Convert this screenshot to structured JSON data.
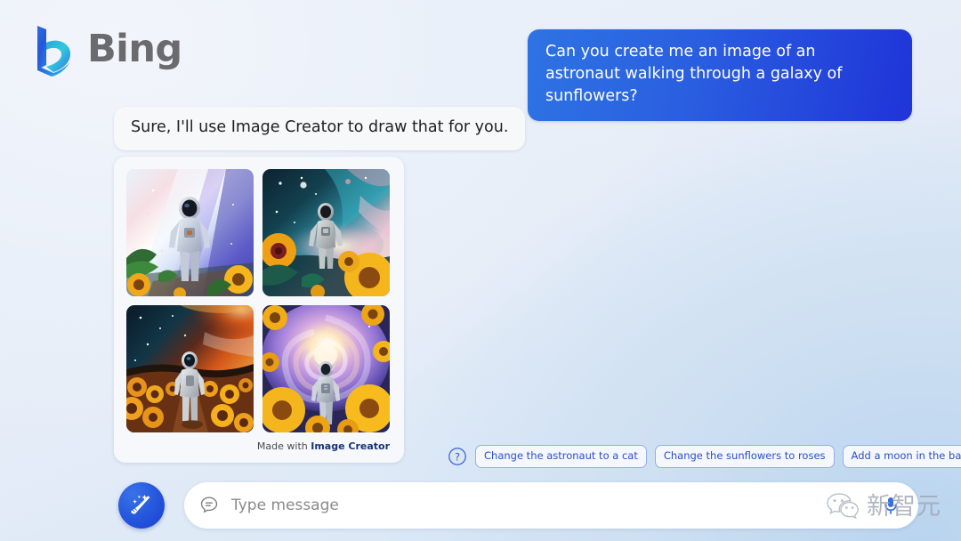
{
  "brand": {
    "name": "Bing",
    "logo_icon": "bing-b-logo-icon",
    "logo_colors": [
      "#2c64d8",
      "#1ea7c8",
      "#3ad0d8"
    ]
  },
  "conversation": {
    "user_message": "Can you create me an image of an astronaut walking through a galaxy of sunflowers?",
    "user_bubble_color": "#2a5fe0",
    "bot_message": "Sure, I'll use Image Creator to draw that for you.",
    "bot_bubble_color": "#f7f8fa"
  },
  "image_results": {
    "attribution_prefix": "Made with ",
    "attribution_brand": "Image Creator",
    "attribution_brand_color": "#18347a",
    "thumbnails": [
      {
        "name": "astronaut-front-nebula-sunflowers",
        "alt": "Astronaut facing forward before a pink and blue nebula streak with sunflowers and green leaves in the foreground"
      },
      {
        "name": "astronaut-walking-teal-galaxy",
        "alt": "Astronaut walking away through a teal and pink galaxy surrounded by large sunflowers"
      },
      {
        "name": "astronaut-orange-sunflower-field",
        "alt": "Astronaut walking down a path through an orange sunflower field under a fiery nebula"
      },
      {
        "name": "astronaut-spiral-galaxy-portal",
        "alt": "Astronaut walking into a glowing spiral galaxy portal framed by bright yellow sunflowers"
      }
    ]
  },
  "suggestions": {
    "help_icon": "question-circle-icon",
    "chips": [
      "Change the astronaut to a cat",
      "Change the sunflowers to roses",
      "Add a moon in the background"
    ],
    "chip_text_color": "#2b50c8",
    "chip_border_color": "#95aee6"
  },
  "composer": {
    "new_topic_icon": "broom-sparkle-icon",
    "new_topic_color": "#2558dd",
    "chat_icon": "chat-bubble-icon",
    "input_value": "",
    "input_placeholder": "Type message",
    "mic_icon": "microphone-icon",
    "mic_color": "#3a6fd8"
  },
  "watermark": {
    "icon": "wechat-logo-icon",
    "text": "新智元"
  }
}
